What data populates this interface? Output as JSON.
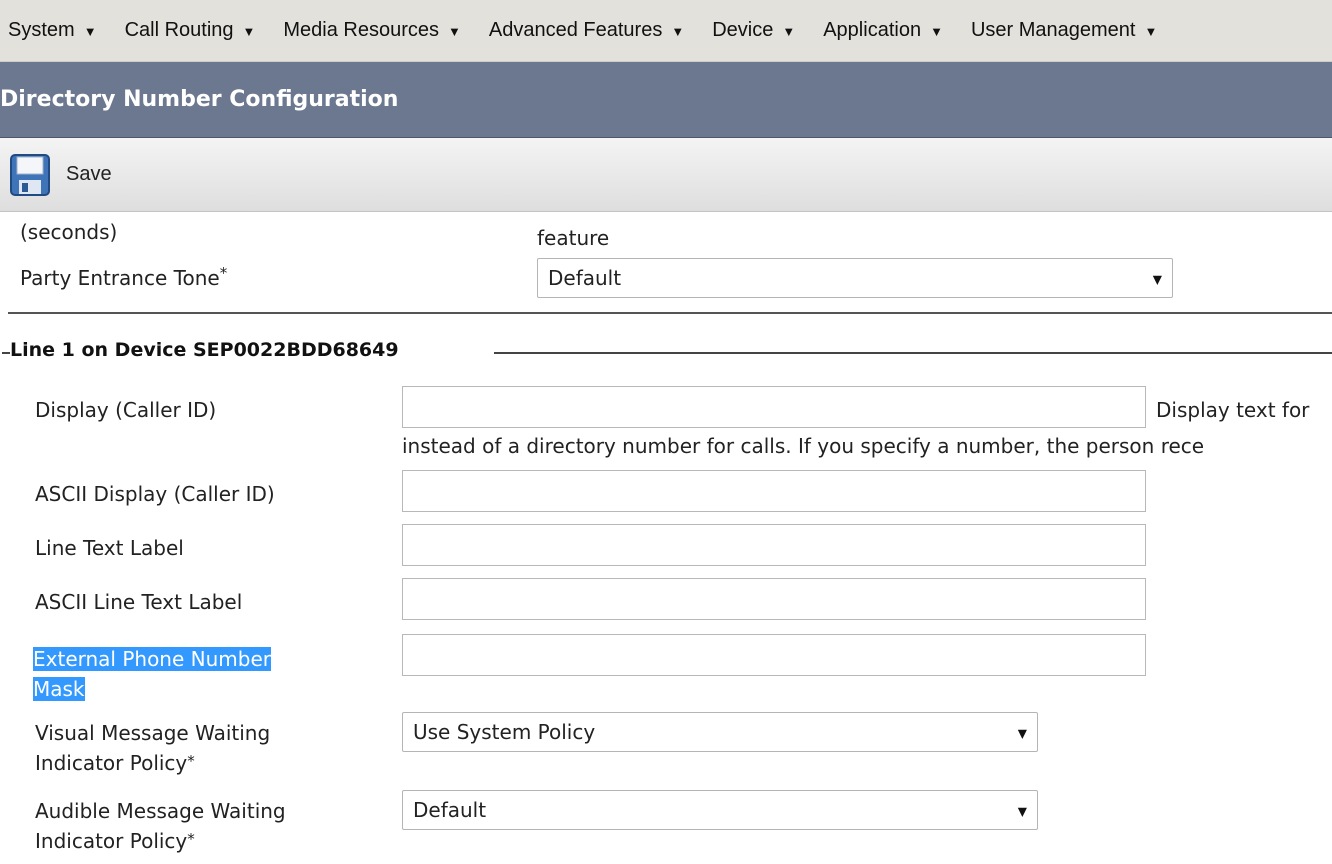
{
  "menu": {
    "items": [
      {
        "label": "System"
      },
      {
        "label": "Call Routing"
      },
      {
        "label": "Media Resources"
      },
      {
        "label": "Advanced Features"
      },
      {
        "label": "Device"
      },
      {
        "label": "Application"
      },
      {
        "label": "User Management"
      }
    ],
    "caret_icon": "chevron-down-icon"
  },
  "header": {
    "title": "Directory Number Configuration"
  },
  "toolbar": {
    "save_label": "Save",
    "save_icon": "floppy-disk-icon"
  },
  "top_section": {
    "seconds_label": "(seconds)",
    "feature_text": "feature",
    "party_entrance_tone_label": "Party Entrance Tone",
    "party_entrance_tone_value": "Default",
    "required_marker": "*"
  },
  "line_section": {
    "legend": "Line 1 on Device SEP0022BDD68649",
    "display_caller_id_label": "Display (Caller ID)",
    "display_caller_id_value": "",
    "display_help_text_1": "Display text for",
    "display_help_text_2": "instead of a directory number for calls. If you specify a number, the person rece",
    "ascii_display_label": "ASCII Display (Caller ID)",
    "ascii_display_value": "",
    "line_text_label_label": "Line Text Label",
    "line_text_label_value": "",
    "ascii_line_text_label_label": "ASCII Line Text Label",
    "ascii_line_text_label_value": "",
    "external_mask_label_1": "External Phone Number",
    "external_mask_label_2": "Mask",
    "external_mask_value": "",
    "visual_mwi_label_1": "Visual Message Waiting",
    "visual_mwi_label_2": "Indicator Policy",
    "visual_mwi_value": "Use System Policy",
    "audible_mwi_label_1": "Audible Message Waiting",
    "audible_mwi_label_2": "Indicator Policy",
    "audible_mwi_value": "Default",
    "required_marker": "*"
  },
  "colors": {
    "menubar_bg": "#e3e1dc",
    "titlebar_bg": "#6c7890",
    "highlight": "#3399ff"
  }
}
